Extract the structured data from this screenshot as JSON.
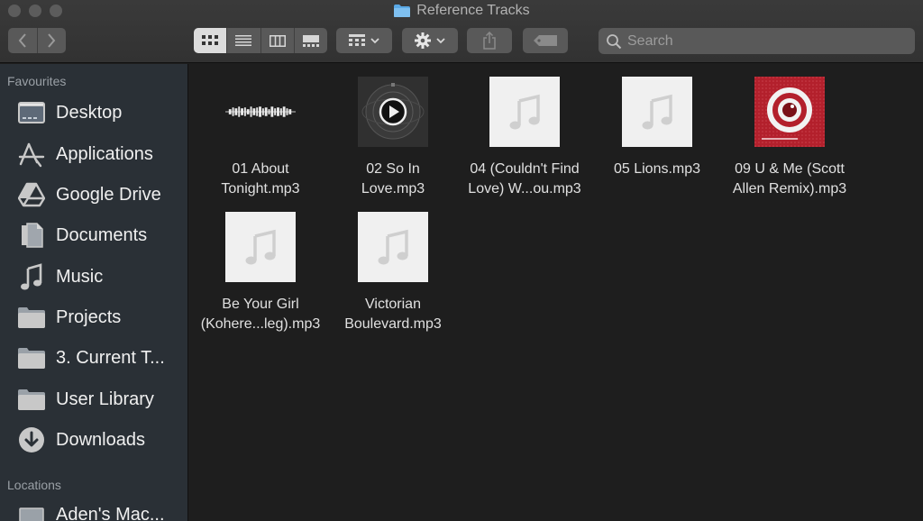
{
  "window": {
    "title": "Reference Tracks"
  },
  "toolbar": {
    "back": "back-chevron-icon",
    "forward": "forward-chevron-icon",
    "view_modes": [
      "icon-view",
      "list-view",
      "column-view",
      "gallery-view"
    ],
    "active_view": "icon-view",
    "search_placeholder": "Search"
  },
  "sidebar": {
    "favourites_label": "Favourites",
    "favourites": [
      {
        "label": "Desktop",
        "icon": "desktop-icon"
      },
      {
        "label": "Applications",
        "icon": "applications-icon"
      },
      {
        "label": "Google Drive",
        "icon": "google-drive-icon"
      },
      {
        "label": "Documents",
        "icon": "documents-icon"
      },
      {
        "label": "Music",
        "icon": "music-icon"
      },
      {
        "label": "Projects",
        "icon": "folder-icon"
      },
      {
        "label": "3. Current T...",
        "icon": "folder-icon"
      },
      {
        "label": "User Library",
        "icon": "folder-icon"
      },
      {
        "label": "Downloads",
        "icon": "downloads-icon"
      }
    ],
    "locations_label": "Locations",
    "locations": [
      {
        "label": "Aden's Mac...",
        "icon": "computer-icon"
      }
    ]
  },
  "files": [
    {
      "line1": "01 About",
      "line2": "Tonight.mp3",
      "thumb": "waveform"
    },
    {
      "line1": "02 So In",
      "line2": "Love.mp3",
      "thumb": "dark-play-artwork"
    },
    {
      "line1": "04 (Couldn't Find",
      "line2": "Love) W...ou.mp3",
      "thumb": "generic-music"
    },
    {
      "line1": "05 Lions.mp3",
      "line2": "",
      "thumb": "generic-music"
    },
    {
      "line1": "09 U & Me (Scott",
      "line2": "Allen Remix).mp3",
      "thumb": "red-album-artwork"
    },
    {
      "line1": "Be Your Girl",
      "line2": "(Kohere...leg).mp3",
      "thumb": "generic-music"
    },
    {
      "line1": "Victorian",
      "line2": "Boulevard.mp3",
      "thumb": "generic-music"
    }
  ],
  "colors": {
    "sidebar_bg": "#2a3036",
    "content_bg": "#1e1e1e",
    "album_red": "#b3202c",
    "folder_blue": "#5aa9e6"
  }
}
